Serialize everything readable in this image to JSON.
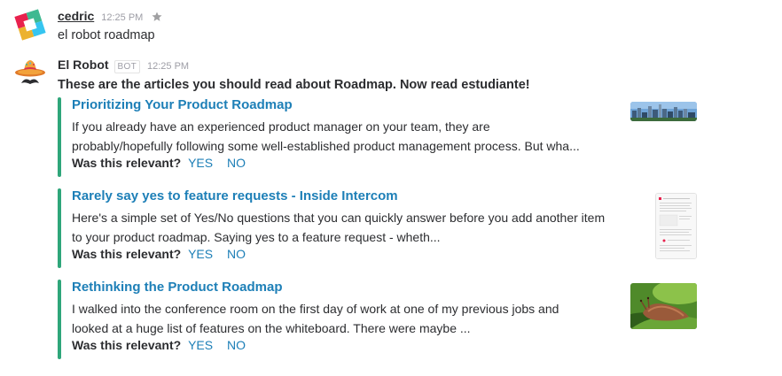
{
  "messages": [
    {
      "author": "cedric",
      "time": "12:25 PM",
      "text": "el robot roadmap"
    },
    {
      "author": "El Robot",
      "badge": "BOT",
      "time": "12:25 PM",
      "text": "These are the articles you should read about Roadmap. Now read estudiante!"
    }
  ],
  "attachments": [
    {
      "title": "Prioritizing Your Product Roadmap",
      "desc_line1": "If you already have an experienced product manager on your team, they are",
      "desc_line2": "probably/hopefully following some well-established product management process. But wha...",
      "relevant_label": "Was this relevant?",
      "yes": "YES",
      "no": "NO",
      "thumb_icon": "city-skyline-image"
    },
    {
      "title": "Rarely say yes to feature requests - Inside Intercom",
      "desc_line1": "Here's a simple set of Yes/No questions that you can quickly answer before you add another item",
      "desc_line2": "to your product roadmap. Saying yes to a feature request - wheth...",
      "relevant_label": "Was this relevant?",
      "yes": "YES",
      "no": "NO",
      "thumb_icon": "document-page-image"
    },
    {
      "title": "Rethinking the Product Roadmap",
      "desc_line1": "I walked into the conference room on the first day of work at one of my previous jobs and",
      "desc_line2": "looked at a huge list of features on the whiteboard. There were maybe ...",
      "relevant_label": "Was this relevant?",
      "yes": "YES",
      "no": "NO",
      "thumb_icon": "slug-image"
    }
  ],
  "colors": {
    "link": "#1d7fb7",
    "attachment_bar": "#2fa67a",
    "timestamp": "#9e9ea6"
  }
}
